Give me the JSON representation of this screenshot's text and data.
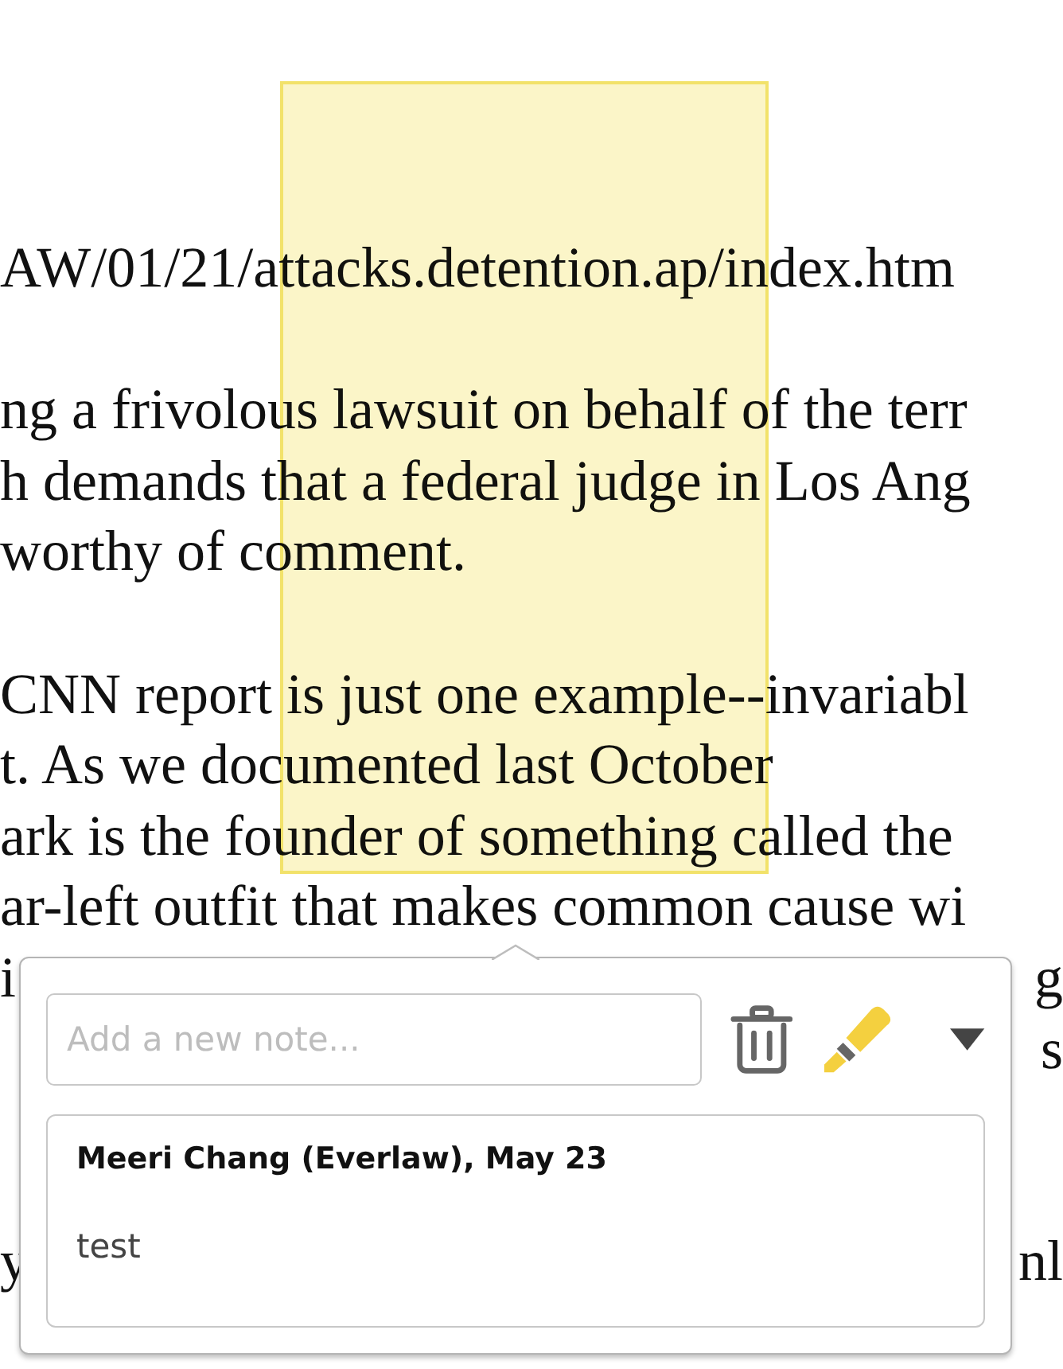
{
  "document": {
    "paragraphs": [
      {
        "lines": [
          {
            "kind": "text",
            "text": "AW/01/21/attacks.detention.ap/index.htm"
          }
        ]
      },
      {
        "lines": [
          {
            "kind": "text",
            "text": "ng a frivolous lawsuit on behalf of the terr"
          },
          {
            "kind": "text",
            "text": "h demands that a federal judge in Los Ang"
          },
          {
            "kind": "text",
            "text": "worthy of comment."
          }
        ]
      },
      {
        "lines": [
          {
            "kind": "text",
            "text": "CNN report is just one example--invariabl"
          },
          {
            "kind": "text",
            "text": "t. As we documented last October"
          },
          {
            "kind": "text",
            "text": "ark is the founder of something called the"
          },
          {
            "kind": "text",
            "text": "ar-left outfit that makes common cause wi"
          },
          {
            "kind": "split",
            "left": "i",
            "right": "g"
          },
          {
            "kind": "split",
            "right": "s"
          }
        ]
      },
      {
        "lines": [
          {
            "kind": "split",
            "left": "y",
            "right": "nl"
          }
        ]
      }
    ]
  },
  "annotation": {
    "note_field": {
      "placeholder": "Add a new note..."
    },
    "notes": [
      {
        "author": "Meeri Chang (Everlaw), May 23",
        "text": "test"
      }
    ]
  }
}
